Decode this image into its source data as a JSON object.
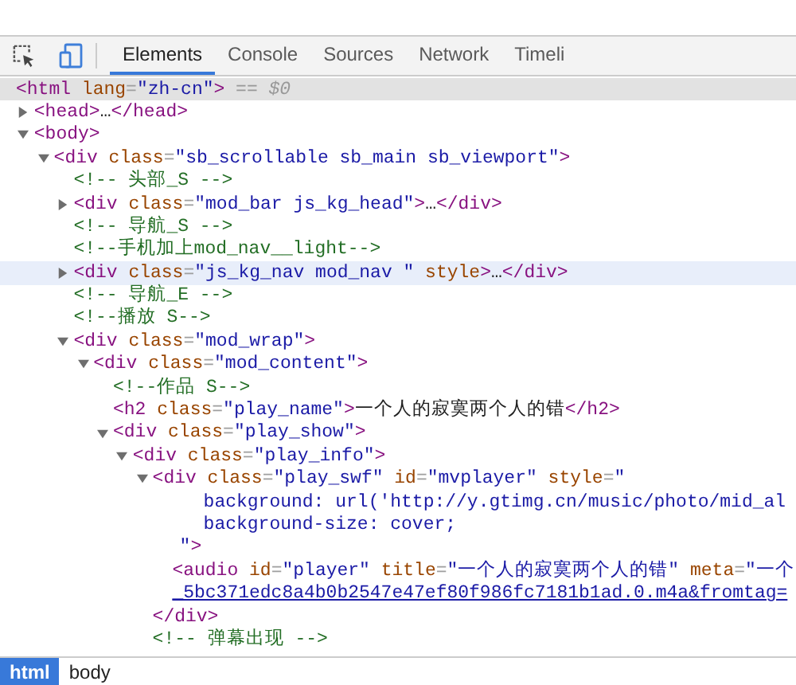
{
  "toolbar": {
    "tabs": [
      {
        "label": "Elements",
        "selected": true
      },
      {
        "label": "Console",
        "selected": false
      },
      {
        "label": "Sources",
        "selected": false
      },
      {
        "label": "Network",
        "selected": false
      },
      {
        "label": "Timeli",
        "selected": false
      }
    ]
  },
  "tree": [
    {
      "selected": true,
      "hovered": false,
      "tokens": [
        {
          "kind": "tag",
          "t": "<html"
        },
        {
          "kind": "attr",
          "t": " lang"
        },
        {
          "kind": "punct",
          "t": "="
        },
        {
          "kind": "value",
          "t": "\"zh-cn\""
        },
        {
          "kind": "tag",
          "t": ">"
        },
        {
          "kind": "dim",
          "t": " == $0"
        }
      ],
      "children": [
        {
          "selected": false,
          "hovered": false,
          "expanded": false,
          "tokens": [
            {
              "kind": "tag",
              "t": "<head>"
            },
            {
              "kind": "text",
              "t": "…"
            },
            {
              "kind": "tag",
              "t": "</head>"
            }
          ]
        },
        {
          "selected": false,
          "hovered": false,
          "expanded": true,
          "tokens": [
            {
              "kind": "tag",
              "t": "<body>"
            }
          ],
          "children": [
            {
              "selected": false,
              "hovered": false,
              "expanded": true,
              "tokens": [
                {
                  "kind": "tag",
                  "t": "<div"
                },
                {
                  "kind": "attr",
                  "t": " class"
                },
                {
                  "kind": "punct",
                  "t": "="
                },
                {
                  "kind": "value",
                  "t": "\"sb_scrollable sb_main sb_viewport\""
                },
                {
                  "kind": "tag",
                  "t": ">"
                }
              ],
              "children": [
                {
                  "selected": false,
                  "hovered": false,
                  "tokens": [
                    {
                      "kind": "comment",
                      "t": "<!-- 头部_S -->"
                    }
                  ]
                },
                {
                  "selected": false,
                  "hovered": false,
                  "expanded": false,
                  "tokens": [
                    {
                      "kind": "tag",
                      "t": "<div"
                    },
                    {
                      "kind": "attr",
                      "t": " class"
                    },
                    {
                      "kind": "punct",
                      "t": "="
                    },
                    {
                      "kind": "value",
                      "t": "\"mod_bar js_kg_head\""
                    },
                    {
                      "kind": "tag",
                      "t": ">"
                    },
                    {
                      "kind": "text",
                      "t": "…"
                    },
                    {
                      "kind": "tag",
                      "t": "</div>"
                    }
                  ]
                },
                {
                  "selected": false,
                  "hovered": false,
                  "tokens": [
                    {
                      "kind": "comment",
                      "t": "<!-- 导航_S -->"
                    }
                  ]
                },
                {
                  "selected": false,
                  "hovered": false,
                  "tokens": [
                    {
                      "kind": "comment",
                      "t": "<!--手机加上mod_nav__light-->"
                    }
                  ]
                },
                {
                  "selected": false,
                  "hovered": true,
                  "expanded": false,
                  "tokens": [
                    {
                      "kind": "tag",
                      "t": "<div"
                    },
                    {
                      "kind": "attr",
                      "t": " class"
                    },
                    {
                      "kind": "punct",
                      "t": "="
                    },
                    {
                      "kind": "value",
                      "t": "\"js_kg_nav mod_nav \""
                    },
                    {
                      "kind": "attr",
                      "t": " style"
                    },
                    {
                      "kind": "tag",
                      "t": ">"
                    },
                    {
                      "kind": "text",
                      "t": "…"
                    },
                    {
                      "kind": "tag",
                      "t": "</div>"
                    }
                  ]
                },
                {
                  "selected": false,
                  "hovered": false,
                  "tokens": [
                    {
                      "kind": "comment",
                      "t": "<!-- 导航_E -->"
                    }
                  ]
                },
                {
                  "selected": false,
                  "hovered": false,
                  "tokens": [
                    {
                      "kind": "comment",
                      "t": "<!--播放 S-->"
                    }
                  ]
                },
                {
                  "selected": false,
                  "hovered": false,
                  "expanded": true,
                  "tokens": [
                    {
                      "kind": "tag",
                      "t": "<div"
                    },
                    {
                      "kind": "attr",
                      "t": " class"
                    },
                    {
                      "kind": "punct",
                      "t": "="
                    },
                    {
                      "kind": "value",
                      "t": "\"mod_wrap\""
                    },
                    {
                      "kind": "tag",
                      "t": ">"
                    }
                  ],
                  "children": [
                    {
                      "selected": false,
                      "hovered": false,
                      "expanded": true,
                      "tokens": [
                        {
                          "kind": "tag",
                          "t": "<div"
                        },
                        {
                          "kind": "attr",
                          "t": " class"
                        },
                        {
                          "kind": "punct",
                          "t": "="
                        },
                        {
                          "kind": "value",
                          "t": "\"mod_content\""
                        },
                        {
                          "kind": "tag",
                          "t": ">"
                        }
                      ],
                      "children": [
                        {
                          "selected": false,
                          "hovered": false,
                          "tokens": [
                            {
                              "kind": "comment",
                              "t": "<!--作品 S-->"
                            }
                          ]
                        },
                        {
                          "selected": false,
                          "hovered": false,
                          "tokens": [
                            {
                              "kind": "tag",
                              "t": "<h2"
                            },
                            {
                              "kind": "attr",
                              "t": " class"
                            },
                            {
                              "kind": "punct",
                              "t": "="
                            },
                            {
                              "kind": "value",
                              "t": "\"play_name\""
                            },
                            {
                              "kind": "tag",
                              "t": ">"
                            },
                            {
                              "kind": "text",
                              "t": "一个人的寂寞两个人的错"
                            },
                            {
                              "kind": "tag",
                              "t": "</h2>"
                            }
                          ]
                        },
                        {
                          "selected": false,
                          "hovered": false,
                          "expanded": true,
                          "tokens": [
                            {
                              "kind": "tag",
                              "t": "<div"
                            },
                            {
                              "kind": "attr",
                              "t": " class"
                            },
                            {
                              "kind": "punct",
                              "t": "="
                            },
                            {
                              "kind": "value",
                              "t": "\"play_show\""
                            },
                            {
                              "kind": "tag",
                              "t": ">"
                            }
                          ],
                          "children": [
                            {
                              "selected": false,
                              "hovered": false,
                              "expanded": true,
                              "tokens": [
                                {
                                  "kind": "tag",
                                  "t": "<div"
                                },
                                {
                                  "kind": "attr",
                                  "t": " class"
                                },
                                {
                                  "kind": "punct",
                                  "t": "="
                                },
                                {
                                  "kind": "value",
                                  "t": "\"play_info\""
                                },
                                {
                                  "kind": "tag",
                                  "t": ">"
                                }
                              ],
                              "children": [
                                {
                                  "selected": false,
                                  "hovered": false,
                                  "expanded": true,
                                  "tokens": [
                                    {
                                      "kind": "tag",
                                      "t": "<div"
                                    },
                                    {
                                      "kind": "attr",
                                      "t": " class"
                                    },
                                    {
                                      "kind": "punct",
                                      "t": "="
                                    },
                                    {
                                      "kind": "value",
                                      "t": "\"play_swf\""
                                    },
                                    {
                                      "kind": "attr",
                                      "t": " id"
                                    },
                                    {
                                      "kind": "punct",
                                      "t": "="
                                    },
                                    {
                                      "kind": "value",
                                      "t": "\"mvplayer\""
                                    },
                                    {
                                      "kind": "attr",
                                      "t": " style"
                                    },
                                    {
                                      "kind": "punct",
                                      "t": "="
                                    },
                                    {
                                      "kind": "value",
                                      "t": "\""
                                    }
                                  ],
                                  "continuation": [
                                    {
                                      "kind": "declaration",
                                      "tokens": [
                                        {
                                          "kind": "value",
                                          "t": "background: url('http://y.gtimg.cn/music/photo/mid_al"
                                        }
                                      ]
                                    },
                                    {
                                      "kind": "declaration",
                                      "tokens": [
                                        {
                                          "kind": "value",
                                          "t": "background-size: cover;"
                                        }
                                      ]
                                    },
                                    {
                                      "kind": "end",
                                      "tokens": [
                                        {
                                          "kind": "value",
                                          "t": "\""
                                        },
                                        {
                                          "kind": "tag",
                                          "t": ">"
                                        }
                                      ]
                                    }
                                  ],
                                  "children": [
                                    {
                                      "selected": false,
                                      "hovered": false,
                                      "tokens": [
                                        {
                                          "kind": "tag",
                                          "t": "<audio"
                                        },
                                        {
                                          "kind": "attr",
                                          "t": " id"
                                        },
                                        {
                                          "kind": "punct",
                                          "t": "="
                                        },
                                        {
                                          "kind": "value",
                                          "t": "\"player\""
                                        },
                                        {
                                          "kind": "attr",
                                          "t": " title"
                                        },
                                        {
                                          "kind": "punct",
                                          "t": "="
                                        },
                                        {
                                          "kind": "value",
                                          "t": "\"一个人的寂寞两个人的错\""
                                        },
                                        {
                                          "kind": "attr",
                                          "t": " meta"
                                        },
                                        {
                                          "kind": "punct",
                                          "t": "="
                                        },
                                        {
                                          "kind": "value",
                                          "t": "\"一个"
                                        }
                                      ],
                                      "continuation": [
                                        {
                                          "kind": "wrap",
                                          "tokens": [
                                            {
                                              "kind": "link",
                                              "t": "_5bc371edc8a4b0b2547e47ef80f986fc7181b1ad.0.m4a&fromtag="
                                            }
                                          ]
                                        }
                                      ]
                                    }
                                  ],
                                  "closing": [
                                    {
                                      "kind": "tag",
                                      "t": "</div>"
                                    }
                                  ]
                                },
                                {
                                  "selected": false,
                                  "hovered": false,
                                  "tokens": [
                                    {
                                      "kind": "comment",
                                      "t": "<!-- 弹幕出现 -->"
                                    }
                                  ]
                                }
                              ]
                            }
                          ]
                        }
                      ]
                    }
                  ]
                }
              ]
            }
          ]
        }
      ]
    }
  ],
  "breadcrumbs": [
    {
      "label": "html",
      "selected": true
    },
    {
      "label": "body",
      "selected": false
    }
  ]
}
